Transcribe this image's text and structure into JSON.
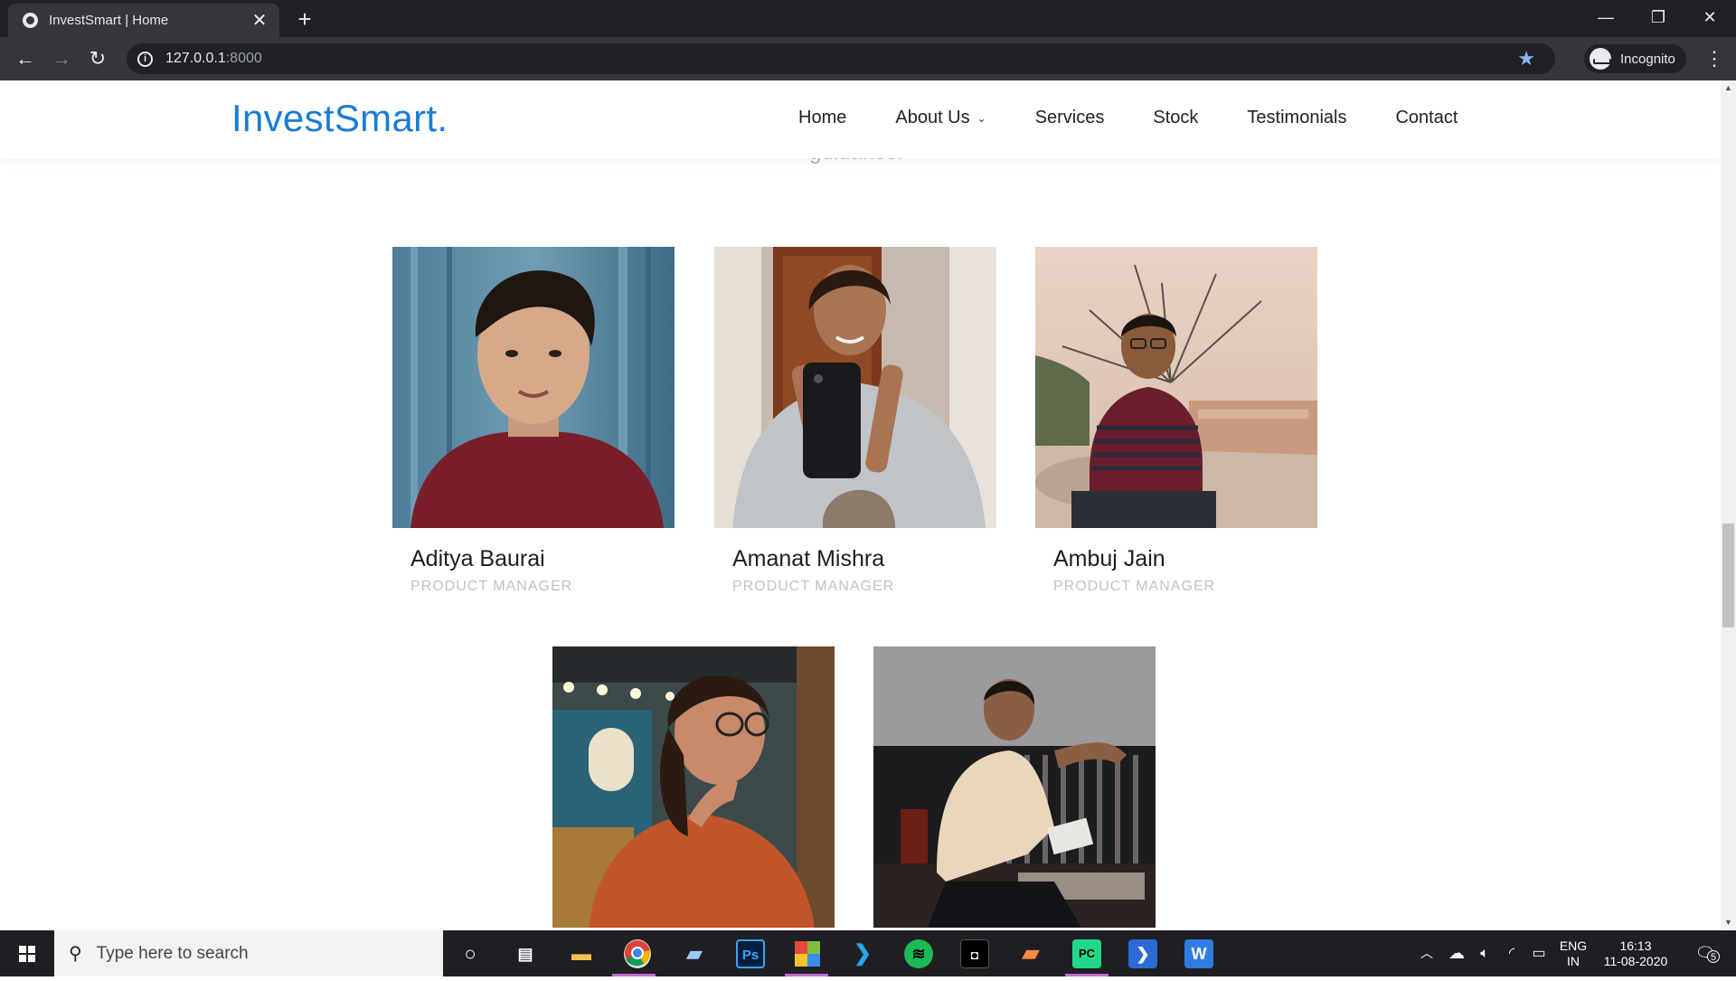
{
  "browser": {
    "tab_title": "InvestSmart | Home",
    "tab_close": "✕",
    "new_tab": "+",
    "url_host": "127.0.0.1",
    "url_port": ":8000",
    "incognito_label": "Incognito"
  },
  "site": {
    "logo": "InvestSmart.",
    "nav": [
      {
        "label": "Home"
      },
      {
        "label": "About Us"
      },
      {
        "label": "Services"
      },
      {
        "label": "Stock"
      },
      {
        "label": "Testimonials"
      },
      {
        "label": "Contact"
      }
    ],
    "partial_text": "guidance."
  },
  "team": [
    {
      "name": "Aditya Baurai",
      "role": "PRODUCT MANAGER"
    },
    {
      "name": "Amanat Mishra",
      "role": "PRODUCT MANAGER"
    },
    {
      "name": "Ambuj Jain",
      "role": "PRODUCT MANAGER"
    },
    {
      "name": "",
      "role": ""
    },
    {
      "name": "",
      "role": ""
    }
  ],
  "taskbar": {
    "search_placeholder": "Type here to search",
    "lang_top": "ENG",
    "lang_bottom": "IN",
    "time": "16:13",
    "date": "11-08-2020",
    "notification_count": "5"
  }
}
